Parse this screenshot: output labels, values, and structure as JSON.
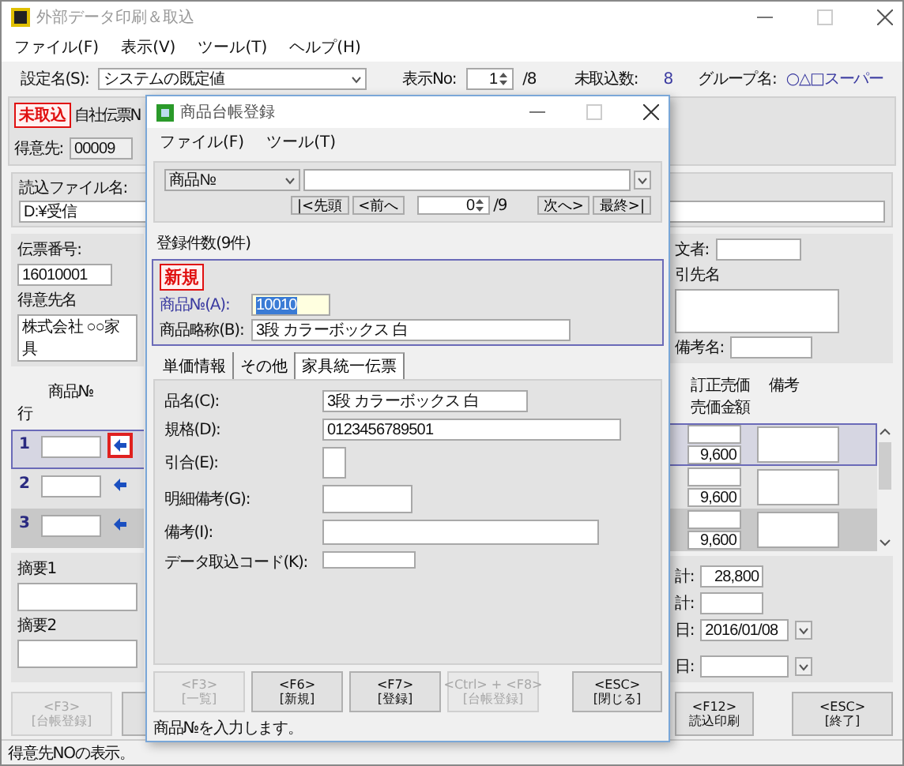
{
  "window": {
    "title": "外部データ印刷＆取込",
    "menu": [
      "ファイル(F)",
      "表示(V)",
      "ツール(T)",
      "ヘルプ(H)"
    ]
  },
  "settings": {
    "label": "設定名(S):",
    "value": "システムの既定値",
    "display_label": "表示No:",
    "display_value": "1",
    "display_total": "/8",
    "pending_label": "未取込数:",
    "pending_value": "8",
    "group_label": "グループ名:",
    "group_value": "○△□スーパー"
  },
  "header": {
    "badge": "未取込",
    "slip_label": "自社伝票N",
    "customer_label": "得意先:",
    "customer_code": "00009"
  },
  "file": {
    "label": "読込ファイル名:",
    "value": "D:¥受信"
  },
  "left": {
    "slip_no_label": "伝票番号:",
    "slip_no": "16010001",
    "customer_name_label": "得意先名",
    "customer_name": "株式会社 ○○家具",
    "col_row": "行",
    "col_item": "商品№",
    "memo1_label": "摘要1",
    "memo2_label": "摘要2",
    "rows": [
      {
        "no": "1",
        "selected": true,
        "highlighted": true
      },
      {
        "no": "2",
        "selected": false,
        "highlighted": false
      },
      {
        "no": "3",
        "selected": false,
        "highlighted": false
      }
    ]
  },
  "right": {
    "orderer_label": "文者:",
    "client_label": "引先名",
    "note_name_label": "備考名:",
    "col_price": "訂正売価",
    "col_amount": "売価金額",
    "col_note": "備考",
    "rows": [
      {
        "amount": "9,600",
        "selected": true
      },
      {
        "amount": "9,600",
        "selected": false
      },
      {
        "amount": "9,600",
        "selected": false
      }
    ],
    "totals": [
      {
        "label": "計:",
        "value": "28,800",
        "kind": "text"
      },
      {
        "label": "計:",
        "kind": "text"
      },
      {
        "label": "日:",
        "value": "2016/01/08",
        "kind": "date"
      },
      {
        "label": "日:",
        "kind": "date"
      }
    ]
  },
  "buttons": [
    {
      "key": "<F3>",
      "label": "[台帳登録]",
      "disabled": true
    },
    {
      "disabled": false
    },
    {
      "key": "<F12>",
      "label": "読込印刷",
      "disabled": false
    },
    {
      "key": "<ESC>",
      "label": "[終了]",
      "disabled": false
    }
  ],
  "status_bar": "得意先NOの表示。",
  "dialog": {
    "title": "商品台帳登録",
    "menu": [
      "ファイル(F)",
      "ツール(T)"
    ],
    "search_field": "商品№",
    "nav_back": [
      "|<先頭",
      "<前へ"
    ],
    "counter": "0",
    "counter_total": "/9",
    "nav_forward": [
      "次へ>",
      "最終>|"
    ],
    "count_label": "登録件数(9件)",
    "badge": "新規",
    "code_label": "商品№(A):",
    "code_value": "10010",
    "short_label": "商品略称(B):",
    "short_value": "3段 カラーボックス 白",
    "tabs": [
      {
        "label": "単価情報",
        "selected": false
      },
      {
        "label": "その他",
        "selected": false
      },
      {
        "label": "家具統一伝票",
        "selected": true
      }
    ],
    "fields": [
      {
        "label": "品名(C):",
        "value": "3段 カラーボックス 白",
        "kind": "medium"
      },
      {
        "label": "規格(D):",
        "value": "0123456789501",
        "kind": "long"
      },
      {
        "label": "引合(E):",
        "kind": "tiny"
      },
      {
        "label": "明細備考(G):",
        "kind": "box"
      },
      {
        "label": "備考(I):",
        "kind": "wide"
      },
      {
        "label": "データ取込コード(K):",
        "kind": "short"
      }
    ],
    "buttons": [
      {
        "key": "<F3>",
        "label": "[一覧]",
        "disabled": true
      },
      {
        "key": "<F6>",
        "label": "[新規]",
        "disabled": false
      },
      {
        "key": "<F7>",
        "label": "[登録]",
        "disabled": false
      },
      {
        "key": "<Ctrl> + <F8>",
        "label": "[台帳登録]",
        "disabled": true
      },
      {
        "key": "<ESC>",
        "label": "[閉じる]",
        "disabled": false
      }
    ],
    "status": "商品№を入力します。"
  }
}
